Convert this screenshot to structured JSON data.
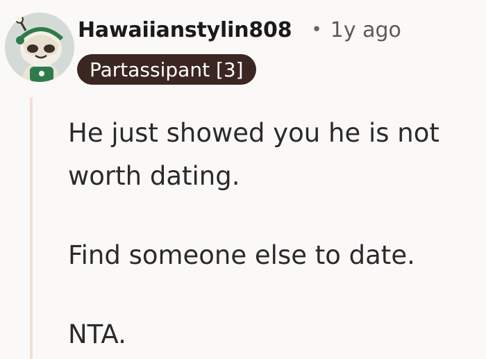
{
  "comment": {
    "username": "Hawaiianstylin808",
    "separator": "•",
    "age": "1y ago",
    "flair": "Partassipant [3]",
    "paragraphs": [
      "He just showed you he is not worth dating.",
      "Find someone else to date.",
      "NTA."
    ]
  },
  "icons": {
    "avatar": "snoo-avatar-icon"
  },
  "colors": {
    "background": "#fbf9f8",
    "flair_background": "#3b2622",
    "flair_text": "#ffffff",
    "thread_line": "#eedfd7",
    "username": "#1a1a1a",
    "meta_text": "#5a5a5a"
  }
}
